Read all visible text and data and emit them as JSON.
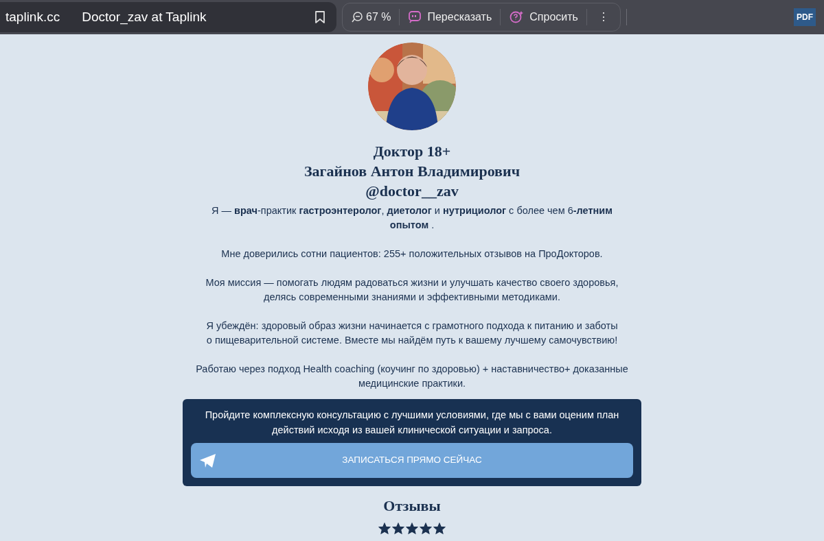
{
  "browser": {
    "domain": "taplink.cc",
    "title": "Doctor_zav at Taplink",
    "zoom": "67 %",
    "retell_button": "Пересказать",
    "ask_button": "Спросить",
    "menu_button": "⋮",
    "pdf_badge": "PDF"
  },
  "profile": {
    "name_lines": [
      "Доктор 18+",
      "Загайнов Антон Владимирович",
      "@doctor__zav"
    ]
  },
  "bio": [
    [
      "Я — **врач**-практик **гастроэнтеролог**, **диетолог** и **нутрициолог** с более чем 6**-летним**",
      "**опытом** ."
    ],
    [
      "Мне доверились сотни пациентов: 255+ положительных отзывов на ПроДокторов."
    ],
    [
      "Моя миссия — помогать людям радоваться жизни и улучшать качество своего здоровья,",
      "делясь современными знаниями и эффективными методиками."
    ],
    [
      "Я убеждён: здоровый образ жизни начинается с грамотного подхода к питанию и заботы",
      "о пищеварительной системе. Вместе мы найдём путь к вашему лучшему самочувствию!"
    ],
    [
      "Работаю через подход Health coaching (коучинг по здоровью) + наставничество+ доказанные",
      "медицинские практики."
    ]
  ],
  "cta": {
    "text_lines": [
      "Пройдите комплексную консультацию с лучшими условиями, где мы с вами оценим план",
      "действий исходя из вашей клинической ситуации и запроса."
    ],
    "button": "ЗАПИСАТЬСЯ ПРЯМО СЕЙЧАС"
  },
  "reviews": {
    "title": "Отзывы",
    "stars": 5
  }
}
